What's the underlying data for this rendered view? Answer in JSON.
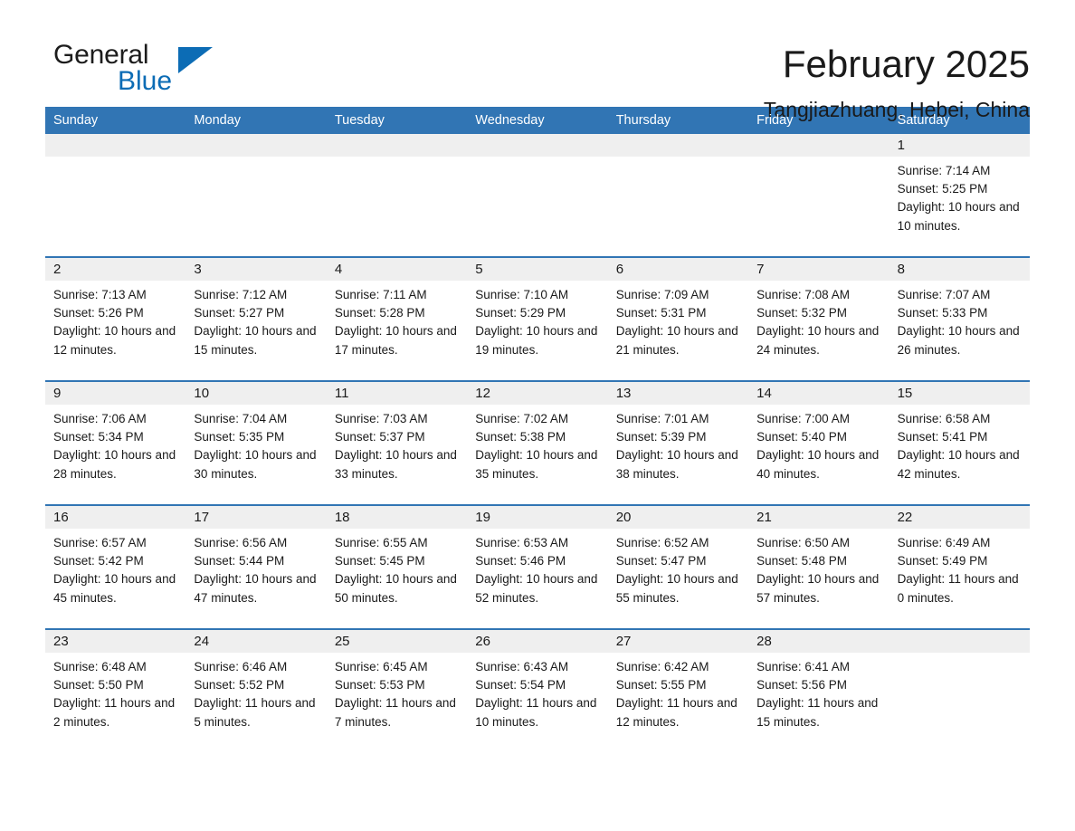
{
  "brand": {
    "name_part1": "General",
    "name_part2": "Blue",
    "accent_color": "#0c6cb5"
  },
  "header": {
    "title": "February 2025",
    "location": "Tangjiazhuang, Hebei, China"
  },
  "calendar": {
    "header_bg": "#3175b4",
    "daynum_bg": "#efefef",
    "weekdays": [
      "Sunday",
      "Monday",
      "Tuesday",
      "Wednesday",
      "Thursday",
      "Friday",
      "Saturday"
    ],
    "weeks": [
      [
        {
          "day": "",
          "sunrise": "",
          "sunset": "",
          "daylight": ""
        },
        {
          "day": "",
          "sunrise": "",
          "sunset": "",
          "daylight": ""
        },
        {
          "day": "",
          "sunrise": "",
          "sunset": "",
          "daylight": ""
        },
        {
          "day": "",
          "sunrise": "",
          "sunset": "",
          "daylight": ""
        },
        {
          "day": "",
          "sunrise": "",
          "sunset": "",
          "daylight": ""
        },
        {
          "day": "",
          "sunrise": "",
          "sunset": "",
          "daylight": ""
        },
        {
          "day": "1",
          "sunrise": "Sunrise: 7:14 AM",
          "sunset": "Sunset: 5:25 PM",
          "daylight": "Daylight: 10 hours and 10 minutes."
        }
      ],
      [
        {
          "day": "2",
          "sunrise": "Sunrise: 7:13 AM",
          "sunset": "Sunset: 5:26 PM",
          "daylight": "Daylight: 10 hours and 12 minutes."
        },
        {
          "day": "3",
          "sunrise": "Sunrise: 7:12 AM",
          "sunset": "Sunset: 5:27 PM",
          "daylight": "Daylight: 10 hours and 15 minutes."
        },
        {
          "day": "4",
          "sunrise": "Sunrise: 7:11 AM",
          "sunset": "Sunset: 5:28 PM",
          "daylight": "Daylight: 10 hours and 17 minutes."
        },
        {
          "day": "5",
          "sunrise": "Sunrise: 7:10 AM",
          "sunset": "Sunset: 5:29 PM",
          "daylight": "Daylight: 10 hours and 19 minutes."
        },
        {
          "day": "6",
          "sunrise": "Sunrise: 7:09 AM",
          "sunset": "Sunset: 5:31 PM",
          "daylight": "Daylight: 10 hours and 21 minutes."
        },
        {
          "day": "7",
          "sunrise": "Sunrise: 7:08 AM",
          "sunset": "Sunset: 5:32 PM",
          "daylight": "Daylight: 10 hours and 24 minutes."
        },
        {
          "day": "8",
          "sunrise": "Sunrise: 7:07 AM",
          "sunset": "Sunset: 5:33 PM",
          "daylight": "Daylight: 10 hours and 26 minutes."
        }
      ],
      [
        {
          "day": "9",
          "sunrise": "Sunrise: 7:06 AM",
          "sunset": "Sunset: 5:34 PM",
          "daylight": "Daylight: 10 hours and 28 minutes."
        },
        {
          "day": "10",
          "sunrise": "Sunrise: 7:04 AM",
          "sunset": "Sunset: 5:35 PM",
          "daylight": "Daylight: 10 hours and 30 minutes."
        },
        {
          "day": "11",
          "sunrise": "Sunrise: 7:03 AM",
          "sunset": "Sunset: 5:37 PM",
          "daylight": "Daylight: 10 hours and 33 minutes."
        },
        {
          "day": "12",
          "sunrise": "Sunrise: 7:02 AM",
          "sunset": "Sunset: 5:38 PM",
          "daylight": "Daylight: 10 hours and 35 minutes."
        },
        {
          "day": "13",
          "sunrise": "Sunrise: 7:01 AM",
          "sunset": "Sunset: 5:39 PM",
          "daylight": "Daylight: 10 hours and 38 minutes."
        },
        {
          "day": "14",
          "sunrise": "Sunrise: 7:00 AM",
          "sunset": "Sunset: 5:40 PM",
          "daylight": "Daylight: 10 hours and 40 minutes."
        },
        {
          "day": "15",
          "sunrise": "Sunrise: 6:58 AM",
          "sunset": "Sunset: 5:41 PM",
          "daylight": "Daylight: 10 hours and 42 minutes."
        }
      ],
      [
        {
          "day": "16",
          "sunrise": "Sunrise: 6:57 AM",
          "sunset": "Sunset: 5:42 PM",
          "daylight": "Daylight: 10 hours and 45 minutes."
        },
        {
          "day": "17",
          "sunrise": "Sunrise: 6:56 AM",
          "sunset": "Sunset: 5:44 PM",
          "daylight": "Daylight: 10 hours and 47 minutes."
        },
        {
          "day": "18",
          "sunrise": "Sunrise: 6:55 AM",
          "sunset": "Sunset: 5:45 PM",
          "daylight": "Daylight: 10 hours and 50 minutes."
        },
        {
          "day": "19",
          "sunrise": "Sunrise: 6:53 AM",
          "sunset": "Sunset: 5:46 PM",
          "daylight": "Daylight: 10 hours and 52 minutes."
        },
        {
          "day": "20",
          "sunrise": "Sunrise: 6:52 AM",
          "sunset": "Sunset: 5:47 PM",
          "daylight": "Daylight: 10 hours and 55 minutes."
        },
        {
          "day": "21",
          "sunrise": "Sunrise: 6:50 AM",
          "sunset": "Sunset: 5:48 PM",
          "daylight": "Daylight: 10 hours and 57 minutes."
        },
        {
          "day": "22",
          "sunrise": "Sunrise: 6:49 AM",
          "sunset": "Sunset: 5:49 PM",
          "daylight": "Daylight: 11 hours and 0 minutes."
        }
      ],
      [
        {
          "day": "23",
          "sunrise": "Sunrise: 6:48 AM",
          "sunset": "Sunset: 5:50 PM",
          "daylight": "Daylight: 11 hours and 2 minutes."
        },
        {
          "day": "24",
          "sunrise": "Sunrise: 6:46 AM",
          "sunset": "Sunset: 5:52 PM",
          "daylight": "Daylight: 11 hours and 5 minutes."
        },
        {
          "day": "25",
          "sunrise": "Sunrise: 6:45 AM",
          "sunset": "Sunset: 5:53 PM",
          "daylight": "Daylight: 11 hours and 7 minutes."
        },
        {
          "day": "26",
          "sunrise": "Sunrise: 6:43 AM",
          "sunset": "Sunset: 5:54 PM",
          "daylight": "Daylight: 11 hours and 10 minutes."
        },
        {
          "day": "27",
          "sunrise": "Sunrise: 6:42 AM",
          "sunset": "Sunset: 5:55 PM",
          "daylight": "Daylight: 11 hours and 12 minutes."
        },
        {
          "day": "28",
          "sunrise": "Sunrise: 6:41 AM",
          "sunset": "Sunset: 5:56 PM",
          "daylight": "Daylight: 11 hours and 15 minutes."
        },
        {
          "day": "",
          "sunrise": "",
          "sunset": "",
          "daylight": ""
        }
      ]
    ]
  }
}
